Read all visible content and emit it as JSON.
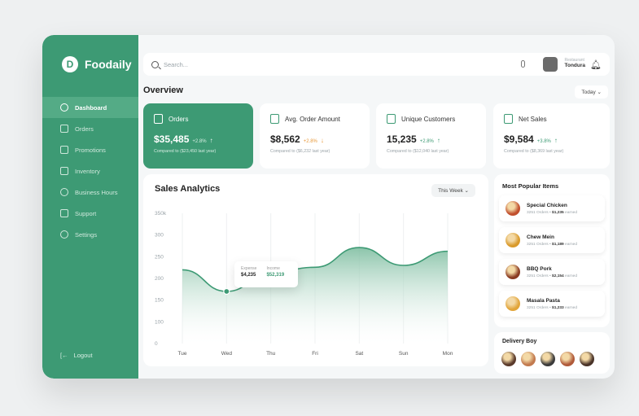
{
  "app": {
    "name": "Foodaily",
    "logo_letter": "D"
  },
  "sidebar": {
    "items": [
      {
        "label": "Dashboard",
        "icon": "clock-icon",
        "active": true
      },
      {
        "label": "Orders",
        "icon": "cart-icon",
        "active": false
      },
      {
        "label": "Promotions",
        "icon": "tag-icon",
        "active": false
      },
      {
        "label": "Inventory",
        "icon": "box-icon",
        "active": false
      },
      {
        "label": "Business Hours",
        "icon": "clock-icon",
        "active": false
      },
      {
        "label": "Support",
        "icon": "phone-icon",
        "active": false
      },
      {
        "label": "Settings",
        "icon": "gear-icon",
        "active": false
      }
    ],
    "logout_label": "Logout"
  },
  "header": {
    "search_placeholder": "Search...",
    "user_role": "Restaurant",
    "user_name": "Tondura"
  },
  "overview": {
    "title": "Overview",
    "range": "Today"
  },
  "stats": [
    {
      "title": "Orders",
      "value": "$35,485",
      "change": "+2.8%",
      "direction": "up",
      "compare": "Compared to ($23,450 last year)"
    },
    {
      "title": "Avg. Order Amount",
      "value": "$8,562",
      "change": "+2.8%",
      "direction": "down",
      "compare": "Compared to ($6,232 last year)"
    },
    {
      "title": "Unique Customers",
      "value": "15,235",
      "change": "+2.8%",
      "direction": "up",
      "compare": "Compared to ($12,040 last year)"
    },
    {
      "title": "Net Sales",
      "value": "$9,584",
      "change": "+3.8%",
      "direction": "up",
      "compare": "Compared to ($8,369 last year)"
    }
  ],
  "analytics": {
    "title": "Sales Analytics",
    "range": "This Week",
    "tooltip": {
      "expense_label": "Expense",
      "expense_value": "$4,235",
      "income_label": "Income",
      "income_value": "$52,319"
    }
  },
  "chart_data": {
    "type": "area",
    "categories": [
      "Tue",
      "Wed",
      "Thu",
      "Fri",
      "Sat",
      "Sun",
      "Mon"
    ],
    "y_tick_labels": [
      "350k",
      "300",
      "250",
      "200",
      "150",
      "100",
      "0"
    ],
    "series": [
      {
        "values": [
          198,
          140,
          190,
          205,
          258,
          210,
          248
        ]
      }
    ],
    "highlight_category": "Wed",
    "ylim": [
      0,
      350
    ],
    "grid": "vertical",
    "colors": {
      "line": "#3d9a74",
      "fill_top": "#7fbea1",
      "fill_bottom": "#ffffff"
    }
  },
  "popular": {
    "title": "Most Popular Items",
    "items": [
      {
        "name": "Special Chicken",
        "orders": "3251 Orders",
        "earned": "$1,235",
        "earned_suffix": "earned",
        "color": "#c1502e"
      },
      {
        "name": "Chew Mein",
        "orders": "3251 Orders",
        "earned": "$1,189",
        "earned_suffix": "earned",
        "color": "#d99a2b"
      },
      {
        "name": "BBQ Pork",
        "orders": "3251 Orders",
        "earned": "$2,154",
        "earned_suffix": "earned",
        "color": "#8a3b22"
      },
      {
        "name": "Masala Pasta",
        "orders": "3251 Orders",
        "earned": "$1,233",
        "earned_suffix": "earned",
        "color": "#e2a53a"
      }
    ]
  },
  "delivery": {
    "title": "Delivery Boy",
    "avatars": [
      "#5a3a2b",
      "#c27a4f",
      "#3b3b3b",
      "#b05a3a",
      "#4a3328"
    ]
  }
}
